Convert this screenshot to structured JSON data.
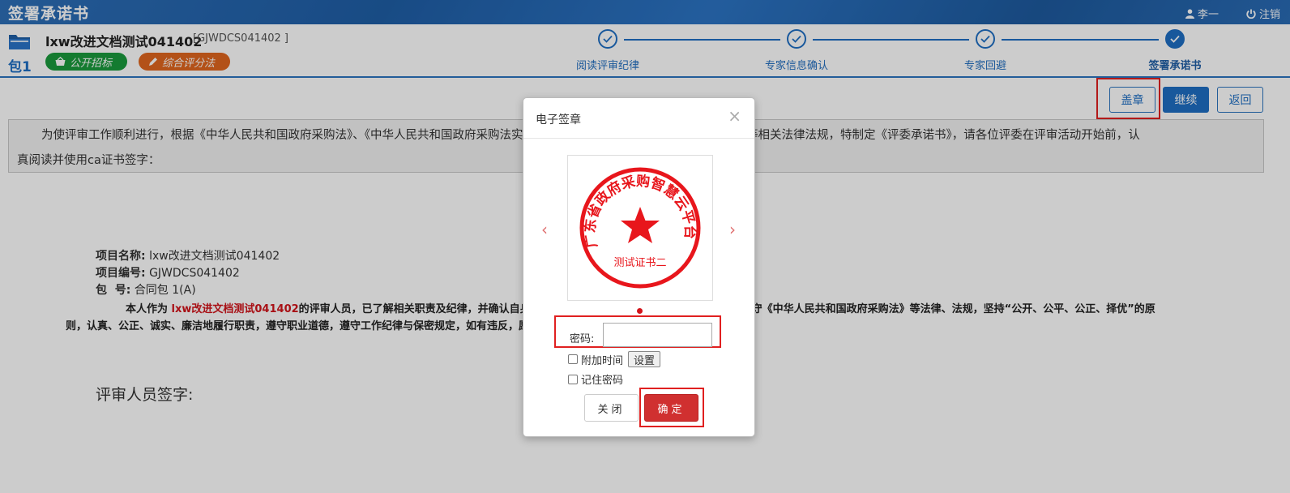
{
  "app": {
    "title": "签署承诺书",
    "user_name": "李一",
    "logout_label": "注销"
  },
  "header": {
    "project_name": "lxw改进文档测试041402",
    "project_code": "[GJWDCS041402 ]",
    "package_label": "包1",
    "tags": [
      {
        "label": "公开招标",
        "color": "#1a9a3c",
        "icon": "basket-icon"
      },
      {
        "label": "综合评分法",
        "color": "#e0661f",
        "icon": "pencil-icon"
      }
    ],
    "steps": [
      {
        "label": "阅读评审纪律",
        "state": "done"
      },
      {
        "label": "专家信息确认",
        "state": "done"
      },
      {
        "label": "专家回避",
        "state": "done"
      },
      {
        "label": "签署承诺书",
        "state": "current"
      }
    ]
  },
  "toolbar": {
    "stamp_label": "盖章",
    "continue_label": "继续",
    "back_label": "返回"
  },
  "notice": {
    "line1": "为使评审工作顺利进行，根据《中华人民共和国政府采购法》、《中华人民共和国政府采购法实施条例》及《政府采购评审专家管理办法》等相关法律法规，特制定《评委承诺书》，请各位评委在评审活动开始前，认",
    "line2": "真阅读并使用ca证书签字："
  },
  "document": {
    "project_name_label": "项目名称:",
    "project_name_value": "lxw改进文档测试041402",
    "project_code_label": "项目编号:",
    "project_code_value": "GJWDCS041402",
    "package_label": "包  号:",
    "package_value": "合同包 1(A)",
    "para_prefix": "本人作为 ",
    "para_project": "lxw改进文档测试041402",
    "para_part1": "的评审人员，已了解相关职责及纪律，并确认自身与本项目无利害关系，承诺在评审过程中严格遵守《中华人民共和国政府采购法》等法律、法规，坚持“公开、公平、公正、择优”的原",
    "para_part2": "则，认真、公正、诚实、廉洁地履行职责，遵守职业道德，遵守工作纪律与保密规定，如有违反，愿意承担个人责任。",
    "signature_label": "评审人员签字:"
  },
  "modal": {
    "title": "电子签章",
    "close_symbol": "×",
    "seal": {
      "ring_text": "广东省政府采购智慧云平台",
      "bottom_text": "测试证书二",
      "color": "#e8161c"
    },
    "prev_symbol": "‹",
    "next_symbol": "›",
    "password_label": "密码:",
    "password_value": "",
    "add_time_label": "附加时间",
    "settings_label": "设置",
    "remember_label": "记住密码",
    "cancel_label": "关闭",
    "confirm_label": "确定"
  }
}
